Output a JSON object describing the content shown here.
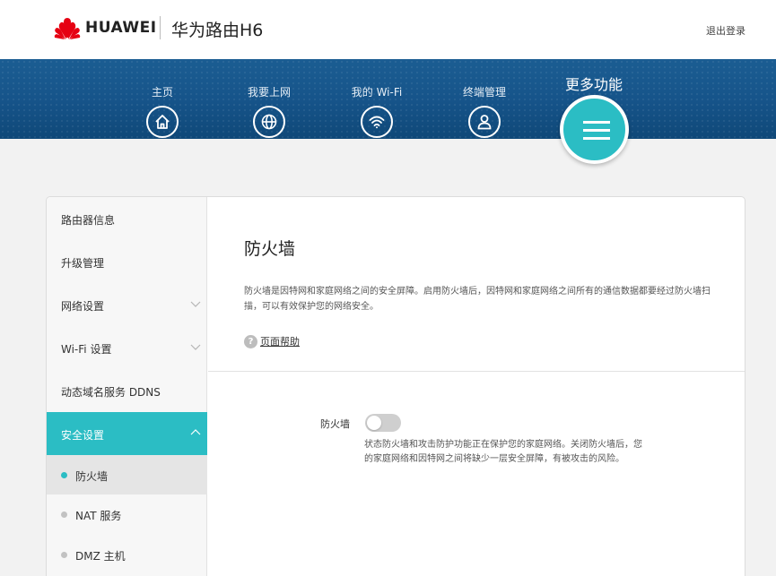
{
  "header": {
    "brand": "HUAWEI",
    "product": "华为路由H6",
    "logout_label": "退出登录"
  },
  "nav": {
    "items": [
      {
        "label": "主页",
        "icon": "home-icon"
      },
      {
        "label": "我要上网",
        "icon": "globe-icon"
      },
      {
        "label": "我的 Wi-Fi",
        "icon": "wifi-icon"
      },
      {
        "label": "终端管理",
        "icon": "user-icon"
      }
    ],
    "more": {
      "label": "更多功能",
      "icon": "menu-icon"
    }
  },
  "sidebar": {
    "items": [
      {
        "label": "路由器信息"
      },
      {
        "label": "升级管理"
      },
      {
        "label": "网络设置",
        "expandable": true
      },
      {
        "label": "Wi-Fi 设置",
        "expandable": true
      },
      {
        "label": "动态域名服务 DDNS"
      },
      {
        "label": "安全设置",
        "expandable": true,
        "active": true
      }
    ],
    "sub_items": [
      {
        "label": "防火墙",
        "current": true
      },
      {
        "label": "NAT 服务"
      },
      {
        "label": "DMZ 主机"
      }
    ]
  },
  "content": {
    "title": "防火墙",
    "description": "防火墙是因特网和家庭网络之间的安全屏障。启用防火墙后，因特网和家庭网络之间所有的通信数据都要经过防火墙扫描，可以有效保护您的网络安全。",
    "help_label": "页面帮助",
    "firewall": {
      "label": "防火墙",
      "enabled": false,
      "status_desc": "状态防火墙和攻击防护功能正在保护您的家庭网络。关闭防火墙后，您的家庭网络和因特网之间将缺少一层安全屏障，有被攻击的风险。"
    }
  },
  "colors": {
    "accent": "#2bbdc4",
    "nav_band": "#16548a",
    "brand_red": "#e60012"
  }
}
